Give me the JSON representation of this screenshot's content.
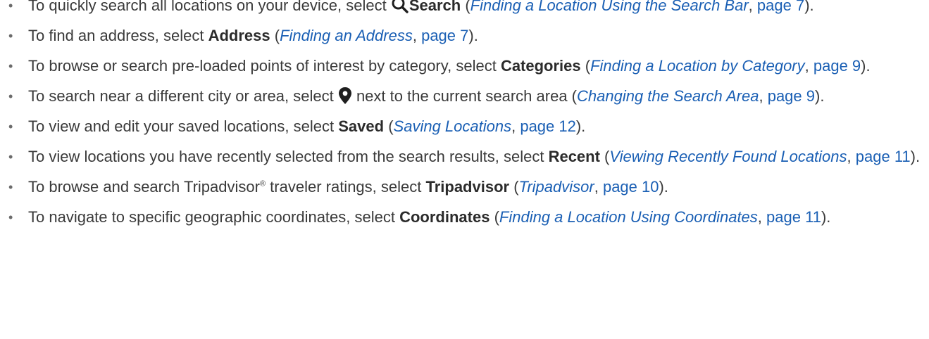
{
  "items": [
    {
      "lead": "To quickly search all locations on your device, select ",
      "icon": "search-icon",
      "keyword": "Search",
      "mid": " (",
      "ref_title": "Finding a Location Using the Search Bar",
      "comma": ", ",
      "ref_page": "page 7",
      "tail": ")."
    },
    {
      "lead": "To find an address, select ",
      "keyword": "Address",
      "mid": " (",
      "ref_title": "Finding an Address",
      "comma": ", ",
      "ref_page": "page 7",
      "tail": ")."
    },
    {
      "lead": "To browse or search pre-loaded points of interest by category, select ",
      "keyword": "Categories",
      "mid": " (",
      "ref_title": "Finding a Location by Category",
      "comma": ", ",
      "ref_page": "page 9",
      "tail": ")."
    },
    {
      "lead": "To search near a different city or area, select ",
      "icon": "map-pin-icon",
      "after_icon": " next to the current search area (",
      "ref_title": "Changing the Search Area",
      "comma": ", ",
      "ref_page": "page 9",
      "tail": ")."
    },
    {
      "lead": "To view and edit your saved locations, select ",
      "keyword": "Saved",
      "mid": " (",
      "ref_title": "Saving Locations",
      "comma": ", ",
      "ref_page": "page 12",
      "tail": ")."
    },
    {
      "lead": "To view locations you have recently selected from the search results, select ",
      "keyword": "Recent",
      "mid": " (",
      "ref_title": "Viewing Recently Found Locations",
      "comma": ", ",
      "ref_page": "page 11",
      "tail": ")."
    },
    {
      "lead": "To browse and search Tripadvisor",
      "reg_mark": "®",
      "lead2": " traveler ratings, select ",
      "keyword": "Tripadvisor",
      "mid": " (",
      "ref_title": "Tripadvisor",
      "comma": ", ",
      "ref_page": "page 10",
      "tail": ")."
    },
    {
      "lead": "To navigate to specific geographic coordinates, select ",
      "keyword": "Coordinates",
      "mid": " (",
      "ref_title": "Finding a Location Using Coordinates",
      "comma": ", ",
      "ref_page": "page 11",
      "tail": ")."
    }
  ],
  "bullet_char": "•",
  "colors": {
    "text": "#3a3a3a",
    "link": "#1a5fb4",
    "bullet": "#6b6b6b"
  }
}
